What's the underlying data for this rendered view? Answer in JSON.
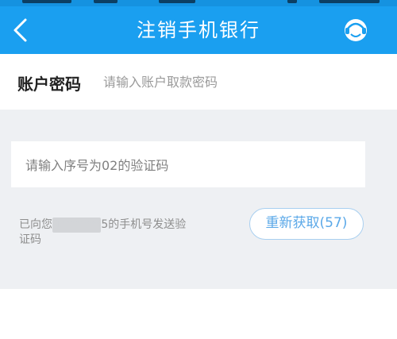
{
  "header": {
    "title": "注销手机银行",
    "back_icon": "chevron-left-icon",
    "service_icon": "customer-service-icon",
    "background": "#1a9ff0"
  },
  "password": {
    "label": "账户密码",
    "placeholder": "请输入账户取款密码"
  },
  "verification": {
    "placeholder": "请输入序号为02的验证码",
    "sent_prefix": "已向您",
    "phone_masked": "1**** ***",
    "sent_suffix": "5的手机号发送验证码",
    "resend_label": "重新获取(57)"
  },
  "colors": {
    "accent": "#1a9ff0",
    "panel": "#eef0f3",
    "resend_text": "#5aa8e8"
  }
}
